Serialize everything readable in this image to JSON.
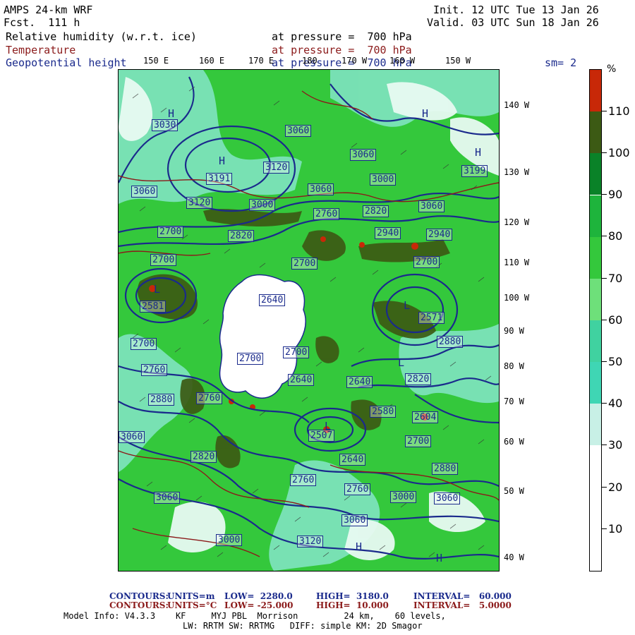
{
  "header": {
    "model": "AMPS 24-km WRF",
    "fcst": "Fcst.  111 h",
    "init": "Init. 12 UTC Tue 13 Jan 26",
    "valid": "Valid. 03 UTC Sun 18 Jan 26"
  },
  "fields": [
    {
      "name": "Relative humidity (w.r.t. ice)",
      "level": "at pressure =  700 hPa",
      "color": "#000000"
    },
    {
      "name": "Temperature",
      "level": "at pressure =  700 hPa",
      "color": "#8b1a1a"
    },
    {
      "name": "Geopotential height",
      "level": "at pressure =  700 hPa",
      "color": "#1a2a8c"
    }
  ],
  "smoothing": "sm= 2",
  "longitude_labels": [
    "150 E",
    "160 E",
    "170 E",
    "180",
    "170 W",
    "160 W",
    "150 W"
  ],
  "latitude_labels": [
    "140 W",
    "130 W",
    "120 W",
    "110 W",
    "100 W",
    "90 W",
    "80 W",
    "70 W",
    "60 W",
    "50 W",
    "40 W"
  ],
  "height_contour_labels": [
    "3030",
    "3060",
    "3120",
    "3191",
    "3060",
    "3060",
    "3000",
    "3120",
    "3060",
    "3000",
    "3199",
    "3060",
    "2940",
    "2820",
    "2760",
    "2820",
    "2700",
    "2940",
    "2700",
    "2700",
    "2640",
    "2700",
    "2700",
    "2880",
    "2700",
    "2760",
    "2880",
    "2760",
    "2820",
    "2700",
    "2640",
    "2640",
    "2820",
    "2580",
    "2760",
    "2700",
    "2880",
    "2640",
    "2760",
    "3000",
    "3060",
    "3060",
    "3000",
    "3120",
    "3060",
    "3060",
    "2581",
    "2507",
    "2571",
    "2604"
  ],
  "hl_markers": [
    "H",
    "H",
    "H",
    "H",
    "L",
    "L",
    "L",
    "L",
    "H",
    "H"
  ],
  "colorbar": {
    "unit": "%",
    "tick_labels": [
      "110",
      "100",
      "90",
      "80",
      "70",
      "60",
      "50",
      "40",
      "30",
      "20",
      "10"
    ],
    "colors": [
      "#ffffff",
      "#ffffff",
      "#ffffff",
      "#c8f0e6",
      "#3fd6b4",
      "#40d2a0",
      "#6ee07a",
      "#34c83c",
      "#1eb43c",
      "#0a8228",
      "#3c5a14",
      "#c82808"
    ]
  },
  "contour_info": {
    "height": {
      "label": "CONTOURS:",
      "units": "UNITS=m",
      "low": "LOW=  2280.0",
      "high": "HIGH=  3180.0",
      "interval": "INTERVAL=   60.000",
      "color": "#1a2a8c"
    },
    "temperature": {
      "label": "CONTOURS:",
      "units": "UNITS=°C",
      "low": "LOW= -25.000",
      "high": "HIGH=  10.000",
      "interval": "INTERVAL=   5.0000",
      "color": "#8b1a1a"
    }
  },
  "model_info": {
    "line1": "Model Info: V4.3.3    KF     MYJ PBL  Morrison         24 km,    60 levels,",
    "line2": "LW: RRTM SW: RRTMG   DIFF: simple KM: 2D Smagor"
  }
}
